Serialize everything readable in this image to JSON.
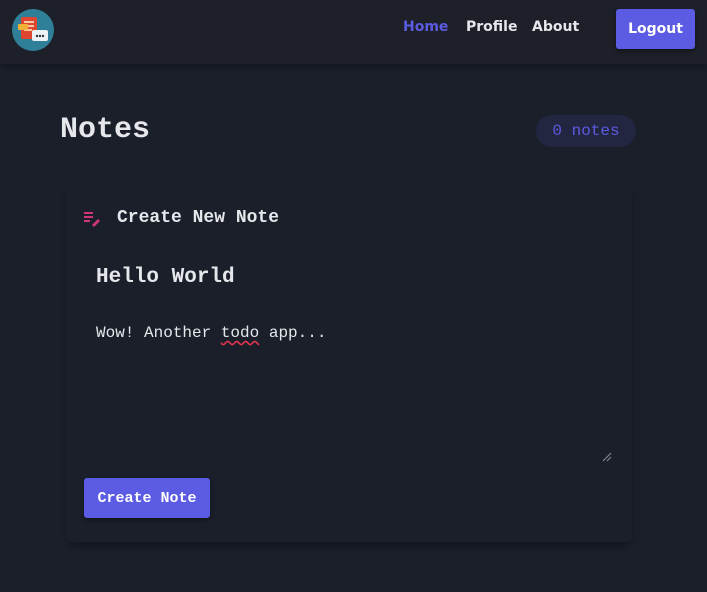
{
  "nav": {
    "links": [
      "Home",
      "Profile",
      "About"
    ],
    "active": "Home",
    "logout_label": "Logout"
  },
  "main": {
    "title": "Notes",
    "count_label": "0 notes"
  },
  "create_card": {
    "heading": "Create New Note",
    "note_title_value": "Hello World",
    "note_body_value": "Wow! Another todo app...",
    "submit_label": "Create Note"
  },
  "colors": {
    "accent": "#5b5be3",
    "background": "#1b1f2a",
    "icon_pink": "#d0357c"
  },
  "icons": {
    "logo": "app-logo-icon",
    "edit": "edit-note-icon"
  }
}
